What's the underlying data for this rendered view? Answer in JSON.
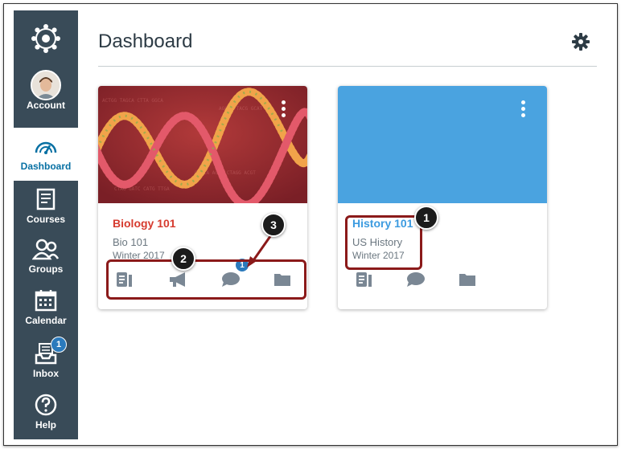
{
  "nav": {
    "items": [
      {
        "label": "Account"
      },
      {
        "label": "Dashboard"
      },
      {
        "label": "Courses"
      },
      {
        "label": "Groups"
      },
      {
        "label": "Calendar"
      },
      {
        "label": "Inbox",
        "badge": "1"
      },
      {
        "label": "Help"
      }
    ]
  },
  "page": {
    "title": "Dashboard"
  },
  "cards": [
    {
      "title": "Biology 101",
      "subtitle": "Bio 101",
      "term": "Winter 2017",
      "title_color": "#d63b2f",
      "discussion_badge": "1"
    },
    {
      "title": "History 101",
      "subtitle": "US History",
      "term": "Winter 2017",
      "title_color": "#3c9be0",
      "hero_color": "#4aa3e0"
    }
  ],
  "callouts": {
    "one": "1",
    "two": "2",
    "three": "3"
  },
  "colors": {
    "nav_bg": "#394b58",
    "accent": "#0770a3",
    "callout_border": "#8b1a1a",
    "badge": "#2b7abc"
  },
  "icons": [
    "canvas-logo-icon",
    "dashboard-icon",
    "courses-icon",
    "groups-icon",
    "calendar-icon",
    "inbox-icon",
    "help-icon",
    "gear-icon",
    "assignments-icon",
    "announcements-icon",
    "discussions-icon",
    "files-icon"
  ]
}
